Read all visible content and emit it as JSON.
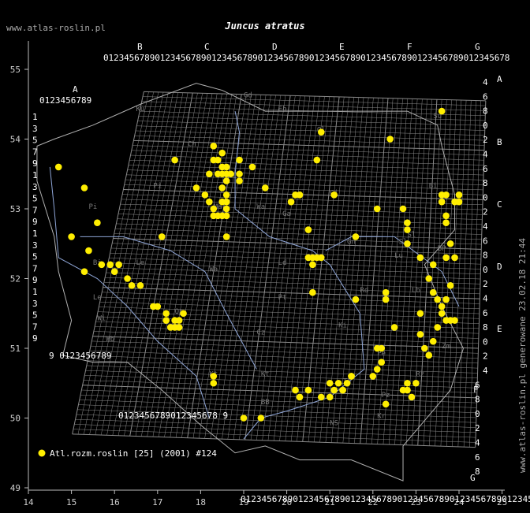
{
  "title": "Juncus atratus",
  "site": "www.atlas-roslin.pl",
  "generated": "www.atlas-roslin.pl generowane 23.02.18 21:44",
  "legend_label": "Atl.rozm.roslin [25] (2001) #124",
  "colors": {
    "marker": "#ffee00",
    "grid": "#9a9a9a",
    "river": "#8fa6d8",
    "border": "#b0b0b0"
  },
  "axes": {
    "x_ticks": [
      "14",
      "15",
      "16",
      "17",
      "18",
      "19",
      "20",
      "21",
      "22",
      "23",
      "24",
      "25"
    ],
    "y_ticks": [
      "55",
      "54",
      "53",
      "52",
      "51",
      "50",
      "49"
    ]
  },
  "column_letters": [
    "A",
    "B",
    "C",
    "D",
    "E",
    "F",
    "G"
  ],
  "row_letters": [
    "A",
    "B",
    "C",
    "D",
    "E",
    "F",
    "G"
  ],
  "top_digits": "0123456789012345678901234567890123456789012345678901234567890123456789012345678",
  "bottom_digits": "0123456789012345678901234567890123456789012345678901234567890123456789012345",
  "left_digits": [
    "1",
    "3",
    "5",
    "7",
    "9",
    "1",
    "3",
    "5",
    "7",
    "9",
    "1",
    "3",
    "5",
    "7",
    "9",
    "1",
    "3",
    "5",
    "7",
    "9"
  ],
  "right_digits": [
    "4",
    "6",
    "8",
    "0",
    "2",
    "4",
    "6",
    "8",
    "0",
    "2",
    "4",
    "6",
    "8",
    "0",
    "2",
    "4",
    "6",
    "8",
    "0",
    "2",
    "4",
    "6",
    "8",
    "0",
    "2",
    "4",
    "6",
    "8"
  ],
  "region_labels": [
    "Ku",
    "Gd",
    "Eb",
    "Su",
    "Ol",
    "Ch",
    "Pi",
    "Bi",
    "Ci",
    "Ma",
    "Wa",
    "Ga",
    "Pi",
    "Sl",
    "Bi",
    "Gn",
    "Ld",
    "Le",
    "BP",
    "Wa",
    "Lu",
    "Le",
    "Pt",
    "Rd",
    "Lb",
    "Wb",
    "Wi",
    "Op",
    "Cz",
    "Ki",
    "Zm",
    "Kt",
    "Kt",
    "Ta",
    "Pe",
    "Pz",
    "Rz",
    "BB",
    "NS",
    "Kr",
    "Sl"
  ],
  "series": [
    {
      "name": "Atl.rozm.roslin [25] (2001) #124",
      "points": [
        [
          14.7,
          53.6
        ],
        [
          15.3,
          53.3
        ],
        [
          15.0,
          52.6
        ],
        [
          15.6,
          52.8
        ],
        [
          15.4,
          52.4
        ],
        [
          15.3,
          52.1
        ],
        [
          15.7,
          52.2
        ],
        [
          15.9,
          52.2
        ],
        [
          16.1,
          52.2
        ],
        [
          16.0,
          52.1
        ],
        [
          16.3,
          52.0
        ],
        [
          16.4,
          51.9
        ],
        [
          16.6,
          51.9
        ],
        [
          16.9,
          51.6
        ],
        [
          17.0,
          51.6
        ],
        [
          17.1,
          52.6
        ],
        [
          17.2,
          51.5
        ],
        [
          17.2,
          51.4
        ],
        [
          17.4,
          51.4
        ],
        [
          17.4,
          51.3
        ],
        [
          17.5,
          51.4
        ],
        [
          17.6,
          51.5
        ],
        [
          17.3,
          51.3
        ],
        [
          17.5,
          51.3
        ],
        [
          17.4,
          53.7
        ],
        [
          17.9,
          53.3
        ],
        [
          18.1,
          53.2
        ],
        [
          18.2,
          53.1
        ],
        [
          18.3,
          53.0
        ],
        [
          18.2,
          53.5
        ],
        [
          18.4,
          53.5
        ],
        [
          18.5,
          53.5
        ],
        [
          18.6,
          53.5
        ],
        [
          18.7,
          53.5
        ],
        [
          18.3,
          53.7
        ],
        [
          18.4,
          53.7
        ],
        [
          18.5,
          53.6
        ],
        [
          18.6,
          53.6
        ],
        [
          18.3,
          53.9
        ],
        [
          18.5,
          53.8
        ],
        [
          18.6,
          53.4
        ],
        [
          18.5,
          53.3
        ],
        [
          18.6,
          53.2
        ],
        [
          18.5,
          53.1
        ],
        [
          18.6,
          53.1
        ],
        [
          18.5,
          52.9
        ],
        [
          18.6,
          52.9
        ],
        [
          18.4,
          52.9
        ],
        [
          18.6,
          53.0
        ],
        [
          18.3,
          52.9
        ],
        [
          18.9,
          53.7
        ],
        [
          18.9,
          53.4
        ],
        [
          19.2,
          53.6
        ],
        [
          18.9,
          53.5
        ],
        [
          19.5,
          53.3
        ],
        [
          18.6,
          52.6
        ],
        [
          20.1,
          53.1
        ],
        [
          20.2,
          53.2
        ],
        [
          20.3,
          53.2
        ],
        [
          20.7,
          53.7
        ],
        [
          20.8,
          54.1
        ],
        [
          20.5,
          52.7
        ],
        [
          20.5,
          52.3
        ],
        [
          20.6,
          52.3
        ],
        [
          20.7,
          52.3
        ],
        [
          20.6,
          52.2
        ],
        [
          20.8,
          52.3
        ],
        [
          21.1,
          53.2
        ],
        [
          21.6,
          52.6
        ],
        [
          22.4,
          54.0
        ],
        [
          22.1,
          53.0
        ],
        [
          22.8,
          52.5
        ],
        [
          22.7,
          53.0
        ],
        [
          22.8,
          52.8
        ],
        [
          22.8,
          52.7
        ],
        [
          23.1,
          52.3
        ],
        [
          23.3,
          52.0
        ],
        [
          23.4,
          52.2
        ],
        [
          23.4,
          51.8
        ],
        [
          23.5,
          51.7
        ],
        [
          23.6,
          51.6
        ],
        [
          23.6,
          51.5
        ],
        [
          23.7,
          51.7
        ],
        [
          23.7,
          51.4
        ],
        [
          23.8,
          51.4
        ],
        [
          23.9,
          51.4
        ],
        [
          23.8,
          51.9
        ],
        [
          23.7,
          52.3
        ],
        [
          23.8,
          52.5
        ],
        [
          23.9,
          52.3
        ],
        [
          23.6,
          53.2
        ],
        [
          23.6,
          53.1
        ],
        [
          23.7,
          53.2
        ],
        [
          23.7,
          52.9
        ],
        [
          23.7,
          52.8
        ],
        [
          23.9,
          53.1
        ],
        [
          24.0,
          53.2
        ],
        [
          24.0,
          53.1
        ],
        [
          23.6,
          54.4
        ],
        [
          23.5,
          51.3
        ],
        [
          23.2,
          51.0
        ],
        [
          23.3,
          50.9
        ],
        [
          23.4,
          51.1
        ],
        [
          23.1,
          51.5
        ],
        [
          23.1,
          51.2
        ],
        [
          22.3,
          51.7
        ],
        [
          22.3,
          51.8
        ],
        [
          22.2,
          51.0
        ],
        [
          22.1,
          51.0
        ],
        [
          22.2,
          50.8
        ],
        [
          22.1,
          50.7
        ],
        [
          22.0,
          50.6
        ],
        [
          22.3,
          50.2
        ],
        [
          22.8,
          50.5
        ],
        [
          22.8,
          50.4
        ],
        [
          22.9,
          50.3
        ],
        [
          22.7,
          50.4
        ],
        [
          21.5,
          50.6
        ],
        [
          21.5,
          50.6
        ],
        [
          21.4,
          50.5
        ],
        [
          21.2,
          50.5
        ],
        [
          21.1,
          50.4
        ],
        [
          21.3,
          50.4
        ],
        [
          21.0,
          50.3
        ],
        [
          20.8,
          50.3
        ],
        [
          20.5,
          50.4
        ],
        [
          20.3,
          50.3
        ],
        [
          20.2,
          50.4
        ],
        [
          20.6,
          51.8
        ],
        [
          21.6,
          51.7
        ],
        [
          22.5,
          51.3
        ],
        [
          23.0,
          50.5
        ],
        [
          18.3,
          50.6
        ],
        [
          18.3,
          50.5
        ],
        [
          19.0,
          50.0
        ],
        [
          19.4,
          50.0
        ],
        [
          21.0,
          50.5
        ],
        [
          21.3,
          50.4
        ]
      ]
    }
  ]
}
